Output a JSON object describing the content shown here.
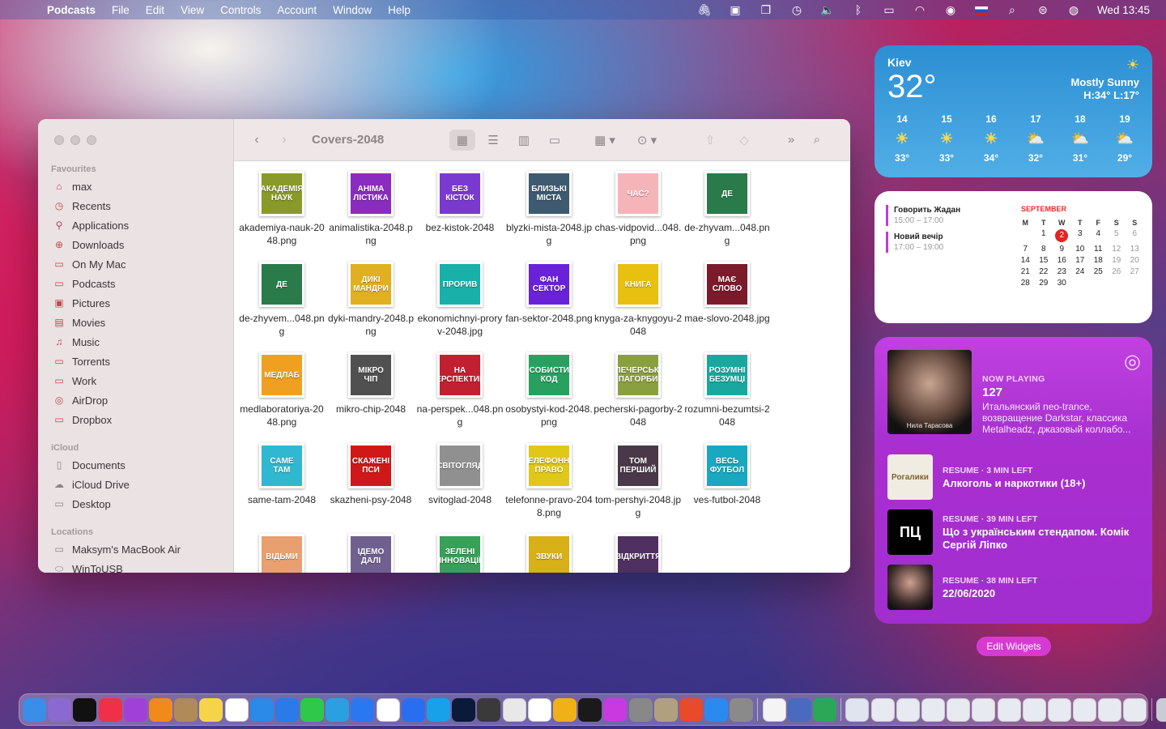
{
  "menubar": {
    "app": "Podcasts",
    "items": [
      "File",
      "Edit",
      "View",
      "Controls",
      "Account",
      "Window",
      "Help"
    ],
    "clock": "Wed 13:45"
  },
  "finder": {
    "title": "Covers-2048",
    "sidebar": {
      "favorites_label": "Favourites",
      "favorites": [
        {
          "label": "max",
          "icon": "home-icon"
        },
        {
          "label": "Recents",
          "icon": "clock-icon"
        },
        {
          "label": "Applications",
          "icon": "applications-icon"
        },
        {
          "label": "Downloads",
          "icon": "download-icon"
        },
        {
          "label": "On My Mac",
          "icon": "folder-icon"
        },
        {
          "label": "Podcasts",
          "icon": "folder-icon"
        },
        {
          "label": "Pictures",
          "icon": "pictures-icon"
        },
        {
          "label": "Movies",
          "icon": "film-icon"
        },
        {
          "label": "Music",
          "icon": "music-icon"
        },
        {
          "label": "Torrents",
          "icon": "folder-icon"
        },
        {
          "label": "Work",
          "icon": "folder-icon"
        },
        {
          "label": "AirDrop",
          "icon": "airdrop-icon"
        },
        {
          "label": "Dropbox",
          "icon": "folder-icon"
        }
      ],
      "icloud_label": "iCloud",
      "icloud": [
        {
          "label": "Documents",
          "icon": "document-icon"
        },
        {
          "label": "iCloud Drive",
          "icon": "cloud-icon"
        },
        {
          "label": "Desktop",
          "icon": "desktop-icon"
        }
      ],
      "locations_label": "Locations",
      "locations": [
        {
          "label": "Maksym's MacBook Air",
          "icon": "laptop-icon"
        },
        {
          "label": "WinToUSB",
          "icon": "drive-icon"
        }
      ]
    },
    "files": [
      {
        "name": "akademiya-nauk-2048.png",
        "art": "АКАДЕМІЯ НАУК",
        "color": "#8a9a2a"
      },
      {
        "name": "animalistika-2048.png",
        "art": "АНІМА ЛІСТИКА",
        "color": "#8a2cc0"
      },
      {
        "name": "bez-kistok-2048",
        "art": "БЕЗ КІСТОК",
        "color": "#7a3ad0"
      },
      {
        "name": "blyzki-mista-2048.jpg",
        "art": "БЛИЗЬКІ МІСТА",
        "color": "#3e5a70"
      },
      {
        "name": "chas-vidpovid...048.png",
        "art": "ЧАС?",
        "color": "#f5b5b8"
      },
      {
        "name": "de-zhyvam...048.png",
        "art": "ДЕ",
        "color": "#2a7a4a"
      },
      {
        "name": "de-zhyvem...048.png",
        "art": "ДЕ",
        "color": "#2a7a4a"
      },
      {
        "name": "dyki-mandry-2048.png",
        "art": "ДИКІ МАНДРИ",
        "color": "#e0b020"
      },
      {
        "name": "ekonomichnyi-proryv-2048.jpg",
        "art": "ПРОРИВ",
        "color": "#18b0a8"
      },
      {
        "name": "fan-sektor-2048.png",
        "art": "ФАН СЕКТОР",
        "color": "#6a22d8"
      },
      {
        "name": "knyga-za-knygoyu-2048",
        "art": "КНИГА",
        "color": "#e8c010"
      },
      {
        "name": "mae-slovo-2048.jpg",
        "art": "МАЄ СЛОВО",
        "color": "#7a1a2a"
      },
      {
        "name": "medlaboratoriya-2048.png",
        "art": "МЕДЛАБ",
        "color": "#f0a020"
      },
      {
        "name": "mikro-chip-2048",
        "art": "МІКРО ЧІП",
        "color": "#505050"
      },
      {
        "name": "na-perspek...048.png",
        "art": "НА ПЕРСПЕКТИВУ",
        "color": "#c02030"
      },
      {
        "name": "osobystyi-kod-2048.png",
        "art": "ОСОБИСТИЙ КОД",
        "color": "#28a060"
      },
      {
        "name": "pecherski-pagorby-2048",
        "art": "ПЕЧЕРСЬКІ ПАГОРБИ",
        "color": "#8aa040"
      },
      {
        "name": "rozumni-bezumtsi-2048",
        "art": "РОЗУМНІ БЕЗУМЦІ",
        "color": "#18a8a0"
      },
      {
        "name": "same-tam-2048",
        "art": "САМЕ ТАМ",
        "color": "#30b8d0"
      },
      {
        "name": "skazheni-psy-2048",
        "art": "СКАЖЕНІ ПСИ",
        "color": "#d01818"
      },
      {
        "name": "svitoglad-2048",
        "art": "СВІТОГЛЯД",
        "color": "#909090"
      },
      {
        "name": "telefonne-pravo-2048.png",
        "art": "ТЕЛЕФОННЕ ПРАВО",
        "color": "#e0c818"
      },
      {
        "name": "tom-pershyi-2048.jpg",
        "art": "ТОМ ПЕРШИЙ",
        "color": "#4a3848"
      },
      {
        "name": "ves-futbol-2048",
        "art": "ВЕСЬ ФУТБОЛ",
        "color": "#18a8c0"
      },
      {
        "name": "",
        "art": "ВІДЬМИ",
        "color": "#e8a070"
      },
      {
        "name": "",
        "art": "ІДЕМО ДАЛІ",
        "color": "#706090"
      },
      {
        "name": "",
        "art": "ЗЕЛЕНІ ІННОВАЦІЇ",
        "color": "#38a058"
      },
      {
        "name": "",
        "art": "ЗВУКИ",
        "color": "#d8b018"
      },
      {
        "name": "",
        "art": "ВІДКРИТТЯ",
        "color": "#503060"
      }
    ]
  },
  "weather": {
    "city": "Kiev",
    "temp": "32°",
    "condition": "Mostly Sunny",
    "hilo": "H:34° L:17°",
    "hours": [
      {
        "h": "14",
        "t": "33°",
        "icon": "sun-icon"
      },
      {
        "h": "15",
        "t": "33°",
        "icon": "sun-icon"
      },
      {
        "h": "16",
        "t": "34°",
        "icon": "sun-icon"
      },
      {
        "h": "17",
        "t": "32°",
        "icon": "partly-cloudy-icon"
      },
      {
        "h": "18",
        "t": "31°",
        "icon": "partly-cloudy-icon"
      },
      {
        "h": "19",
        "t": "29°",
        "icon": "partly-cloudy-icon"
      }
    ]
  },
  "calendar": {
    "month": "SEPTEMBER",
    "days_header": [
      "M",
      "T",
      "W",
      "T",
      "F",
      "S",
      "S"
    ],
    "events": [
      {
        "title": "Говорить Жадан",
        "time": "15:00 – 17:00"
      },
      {
        "title": "Новий вечір",
        "time": "17:00 – 19:00"
      }
    ],
    "weeks": [
      [
        "",
        "1",
        "2",
        "3",
        "4",
        "5",
        "6"
      ],
      [
        "7",
        "8",
        "9",
        "10",
        "11",
        "12",
        "13"
      ],
      [
        "14",
        "15",
        "16",
        "17",
        "18",
        "19",
        "20"
      ],
      [
        "21",
        "22",
        "23",
        "24",
        "25",
        "26",
        "27"
      ],
      [
        "28",
        "29",
        "30",
        "",
        "",
        "",
        ""
      ]
    ],
    "today": "2"
  },
  "podcasts": {
    "now_label": "NOW PLAYING",
    "episode": "127",
    "desc": "Итальянский neo-trance, возвращение Darkstar, классика Metalheadz, джазовый коллабо...",
    "art_caption": "Нила Тарасова",
    "resume": [
      {
        "label": "RESUME · 3 MIN LEFT",
        "title": "Алкоголь и наркотики (18+)",
        "art": "Рогалики"
      },
      {
        "label": "RESUME · 39 MIN LEFT",
        "title": "Що з українським стендапом. Комік Сергій Ліпко",
        "art": "ПЦ"
      },
      {
        "label": "RESUME · 38 MIN LEFT",
        "title": "22/06/2020",
        "art": ""
      }
    ],
    "edit_label": "Edit Widgets"
  },
  "dock": [
    {
      "n": "finder-icon",
      "c": "#3b8ee8"
    },
    {
      "n": "launchpad-icon",
      "c": "#8a6ad0"
    },
    {
      "n": "apple-tv-icon",
      "c": "#111"
    },
    {
      "n": "music-icon",
      "c": "#f03048"
    },
    {
      "n": "podcasts-icon",
      "c": "#a040d8"
    },
    {
      "n": "books-icon",
      "c": "#f08a18"
    },
    {
      "n": "contacts-icon",
      "c": "#b08a58"
    },
    {
      "n": "notes-icon",
      "c": "#f6d44a"
    },
    {
      "n": "calendar-icon",
      "c": "#fff"
    },
    {
      "n": "safari-icon",
      "c": "#2a8ae8"
    },
    {
      "n": "mail-icon",
      "c": "#2a7ae8"
    },
    {
      "n": "messages-icon",
      "c": "#30c84a"
    },
    {
      "n": "telegram-icon",
      "c": "#2aa0e0"
    },
    {
      "n": "messenger-icon",
      "c": "#2a78f0"
    },
    {
      "n": "slack-icon",
      "c": "#fff"
    },
    {
      "n": "zoom-icon",
      "c": "#2a6ef0"
    },
    {
      "n": "skype-icon",
      "c": "#18a0e8"
    },
    {
      "n": "photoshop-icon",
      "c": "#0a1a38"
    },
    {
      "n": "sublime-icon",
      "c": "#3a3a3a"
    },
    {
      "n": "chrome-icon",
      "c": "#e8e8e8"
    },
    {
      "n": "notion-icon",
      "c": "#fff"
    },
    {
      "n": "cyberduck-icon",
      "c": "#f0b018"
    },
    {
      "n": "spotify-icon",
      "c": "#1a1a1a"
    },
    {
      "n": "headphones-icon",
      "c": "#c83ae0"
    },
    {
      "n": "automator-icon",
      "c": "#888"
    },
    {
      "n": "archive-icon",
      "c": "#b0a080"
    },
    {
      "n": "remote-icon",
      "c": "#e84a2a"
    },
    {
      "n": "app-store-icon",
      "c": "#2a8af0"
    },
    {
      "n": "settings-icon",
      "c": "#8a8a8a"
    },
    {
      "n": "sep"
    },
    {
      "n": "text-editor-icon",
      "c": "#f4f4f4"
    },
    {
      "n": "preview-icon",
      "c": "#4a6ac0"
    },
    {
      "n": "numbers-icon",
      "c": "#2aa858"
    },
    {
      "n": "sep"
    },
    {
      "n": "window-thumb-icon",
      "c": "#e0e4ee"
    },
    {
      "n": "window-thumb-icon",
      "c": "#e8eaf2"
    },
    {
      "n": "window-thumb-icon",
      "c": "#e8eaf2"
    },
    {
      "n": "window-thumb-icon",
      "c": "#e8eaf2"
    },
    {
      "n": "window-thumb-icon",
      "c": "#e8eaf2"
    },
    {
      "n": "window-thumb-icon",
      "c": "#e8eaf2"
    },
    {
      "n": "window-thumb-icon",
      "c": "#e8eaf2"
    },
    {
      "n": "window-thumb-icon",
      "c": "#e8eaf2"
    },
    {
      "n": "window-thumb-icon",
      "c": "#e8eaf2"
    },
    {
      "n": "window-thumb-icon",
      "c": "#e8eaf2"
    },
    {
      "n": "window-thumb-icon",
      "c": "#e8eaf2"
    },
    {
      "n": "window-thumb-icon",
      "c": "#e8eaf2"
    },
    {
      "n": "sep"
    },
    {
      "n": "trash-icon",
      "c": "#c8ccd4"
    }
  ]
}
